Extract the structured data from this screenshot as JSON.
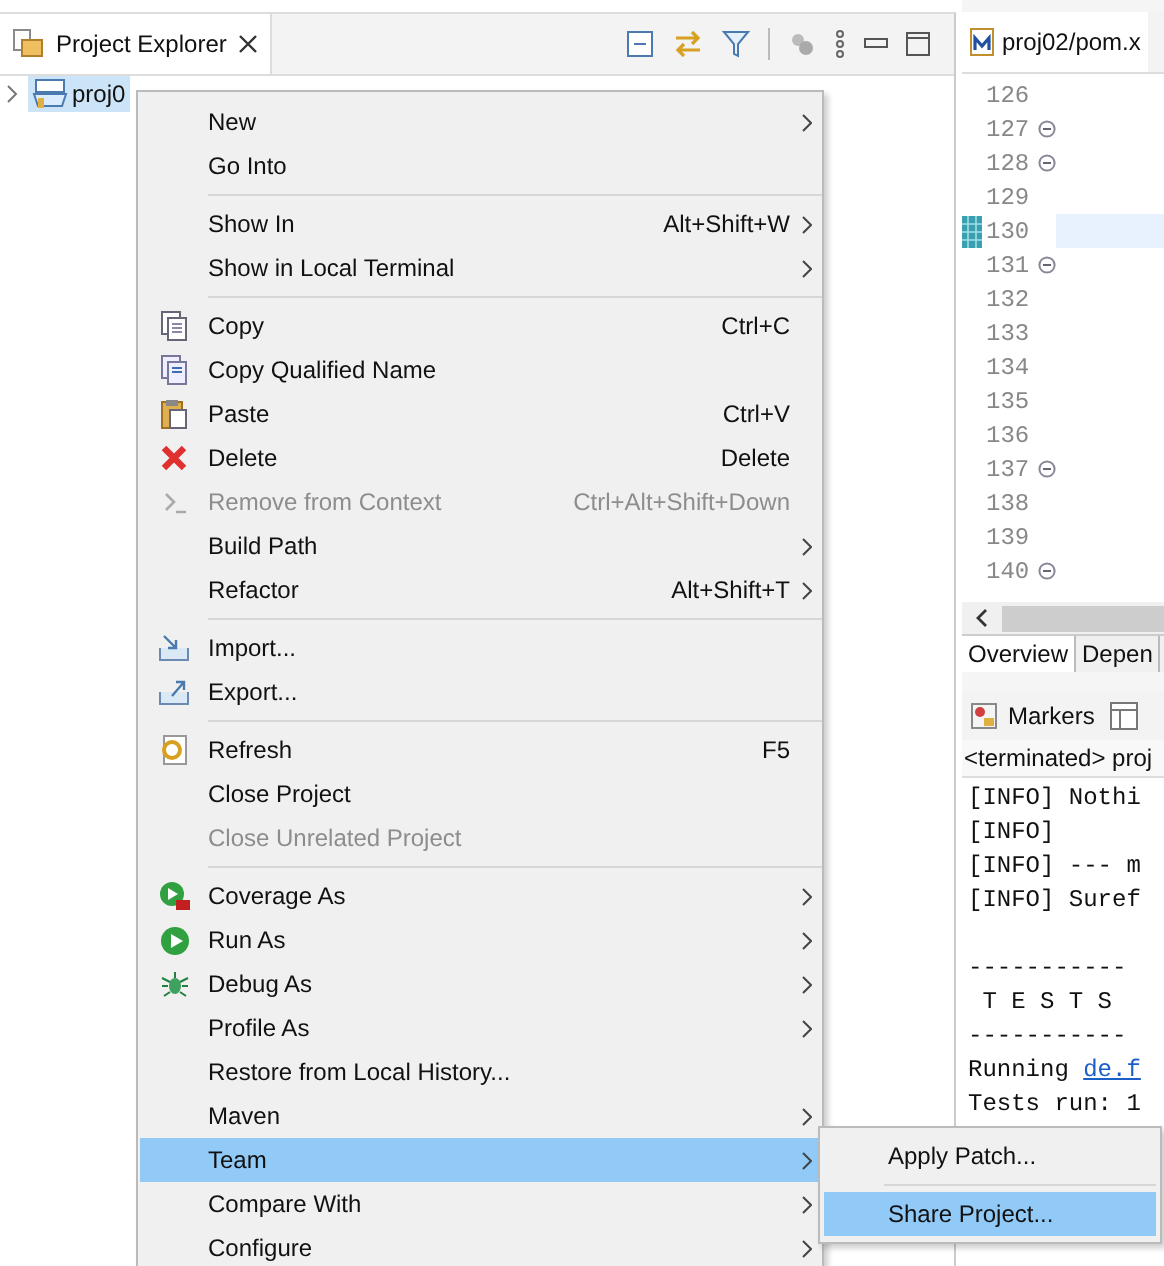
{
  "explorer": {
    "title": "Project Explorer",
    "tree": [
      {
        "label": "proj0",
        "selected": true
      }
    ]
  },
  "context_menu": {
    "items": [
      {
        "kind": "item",
        "label": "New",
        "submenu": true,
        "disabled": false,
        "selected": false
      },
      {
        "kind": "item",
        "label": "Go Into",
        "submenu": false,
        "disabled": false,
        "selected": false
      },
      {
        "kind": "separator"
      },
      {
        "kind": "item",
        "label": "Show In",
        "shortcut": "Alt+Shift+W",
        "submenu": true,
        "disabled": false,
        "selected": false
      },
      {
        "kind": "item",
        "label": "Show in Local Terminal",
        "submenu": true,
        "disabled": false,
        "selected": false
      },
      {
        "kind": "separator"
      },
      {
        "kind": "item",
        "label": "Copy",
        "shortcut": "Ctrl+C",
        "submenu": false,
        "disabled": false,
        "selected": false
      },
      {
        "kind": "item",
        "label": "Copy Qualified Name",
        "submenu": false,
        "disabled": false,
        "selected": false
      },
      {
        "kind": "item",
        "label": "Paste",
        "shortcut": "Ctrl+V",
        "submenu": false,
        "disabled": false,
        "selected": false
      },
      {
        "kind": "item",
        "label": "Delete",
        "shortcut": "Delete",
        "submenu": false,
        "disabled": false,
        "selected": false
      },
      {
        "kind": "item",
        "label": "Remove from Context",
        "shortcut": "Ctrl+Alt+Shift+Down",
        "submenu": false,
        "disabled": true,
        "selected": false
      },
      {
        "kind": "item",
        "label": "Build Path",
        "submenu": true,
        "disabled": false,
        "selected": false
      },
      {
        "kind": "item",
        "label": "Refactor",
        "shortcut": "Alt+Shift+T",
        "submenu": true,
        "disabled": false,
        "selected": false
      },
      {
        "kind": "separator"
      },
      {
        "kind": "item",
        "label": "Import...",
        "submenu": false,
        "disabled": false,
        "selected": false
      },
      {
        "kind": "item",
        "label": "Export...",
        "submenu": false,
        "disabled": false,
        "selected": false
      },
      {
        "kind": "separator"
      },
      {
        "kind": "item",
        "label": "Refresh",
        "shortcut": "F5",
        "submenu": false,
        "disabled": false,
        "selected": false
      },
      {
        "kind": "item",
        "label": "Close Project",
        "submenu": false,
        "disabled": false,
        "selected": false
      },
      {
        "kind": "item",
        "label": "Close Unrelated Project",
        "submenu": false,
        "disabled": true,
        "selected": false
      },
      {
        "kind": "separator"
      },
      {
        "kind": "item",
        "label": "Coverage As",
        "submenu": true,
        "disabled": false,
        "selected": false
      },
      {
        "kind": "item",
        "label": "Run As",
        "submenu": true,
        "disabled": false,
        "selected": false
      },
      {
        "kind": "item",
        "label": "Debug As",
        "submenu": true,
        "disabled": false,
        "selected": false
      },
      {
        "kind": "item",
        "label": "Profile As",
        "submenu": true,
        "disabled": false,
        "selected": false
      },
      {
        "kind": "item",
        "label": "Restore from Local History...",
        "submenu": false,
        "disabled": false,
        "selected": false
      },
      {
        "kind": "item",
        "label": "Maven",
        "submenu": true,
        "disabled": false,
        "selected": false
      },
      {
        "kind": "item",
        "label": "Team",
        "submenu": true,
        "disabled": false,
        "selected": true
      },
      {
        "kind": "item",
        "label": "Compare With",
        "submenu": true,
        "disabled": false,
        "selected": false
      },
      {
        "kind": "item",
        "label": "Configure",
        "submenu": true,
        "disabled": false,
        "selected": false
      }
    ]
  },
  "team_submenu": {
    "items": [
      {
        "label": "Apply Patch...",
        "selected": false
      },
      {
        "label": "Share Project...",
        "selected": true
      }
    ]
  },
  "editor": {
    "tab": "proj02/pom.x",
    "lines": [
      {
        "number": "126",
        "fold": false,
        "current": false
      },
      {
        "number": "127",
        "fold": true,
        "current": false
      },
      {
        "number": "128",
        "fold": true,
        "current": false
      },
      {
        "number": "129",
        "fold": false,
        "current": false
      },
      {
        "number": "130",
        "fold": false,
        "current": true
      },
      {
        "number": "131",
        "fold": true,
        "current": false
      },
      {
        "number": "132",
        "fold": false,
        "current": false
      },
      {
        "number": "133",
        "fold": false,
        "current": false
      },
      {
        "number": "134",
        "fold": false,
        "current": false
      },
      {
        "number": "135",
        "fold": false,
        "current": false
      },
      {
        "number": "136",
        "fold": false,
        "current": false
      },
      {
        "number": "137",
        "fold": true,
        "current": false
      },
      {
        "number": "138",
        "fold": false,
        "current": false
      },
      {
        "number": "139",
        "fold": false,
        "current": false
      },
      {
        "number": "140",
        "fold": true,
        "current": false
      }
    ],
    "bottom_tabs": [
      {
        "label": "Overview",
        "selected": true
      },
      {
        "label": "Depen",
        "selected": false
      }
    ]
  },
  "console": {
    "tab": "Markers",
    "header": "<terminated> proj",
    "lines": [
      {
        "kind": "text",
        "text": "[INFO] Nothi"
      },
      {
        "kind": "text",
        "text": "[INFO]"
      },
      {
        "kind": "text",
        "text": "[INFO] --- m"
      },
      {
        "kind": "text",
        "text": "[INFO] Suref"
      },
      {
        "kind": "blank"
      },
      {
        "kind": "text",
        "text": "-----------"
      },
      {
        "kind": "text",
        "text": " T E S T S"
      },
      {
        "kind": "text",
        "text": "-----------"
      },
      {
        "kind": "link",
        "text": "Running ",
        "link": "de.f"
      },
      {
        "kind": "text",
        "text": "Tests run: 1"
      }
    ]
  }
}
